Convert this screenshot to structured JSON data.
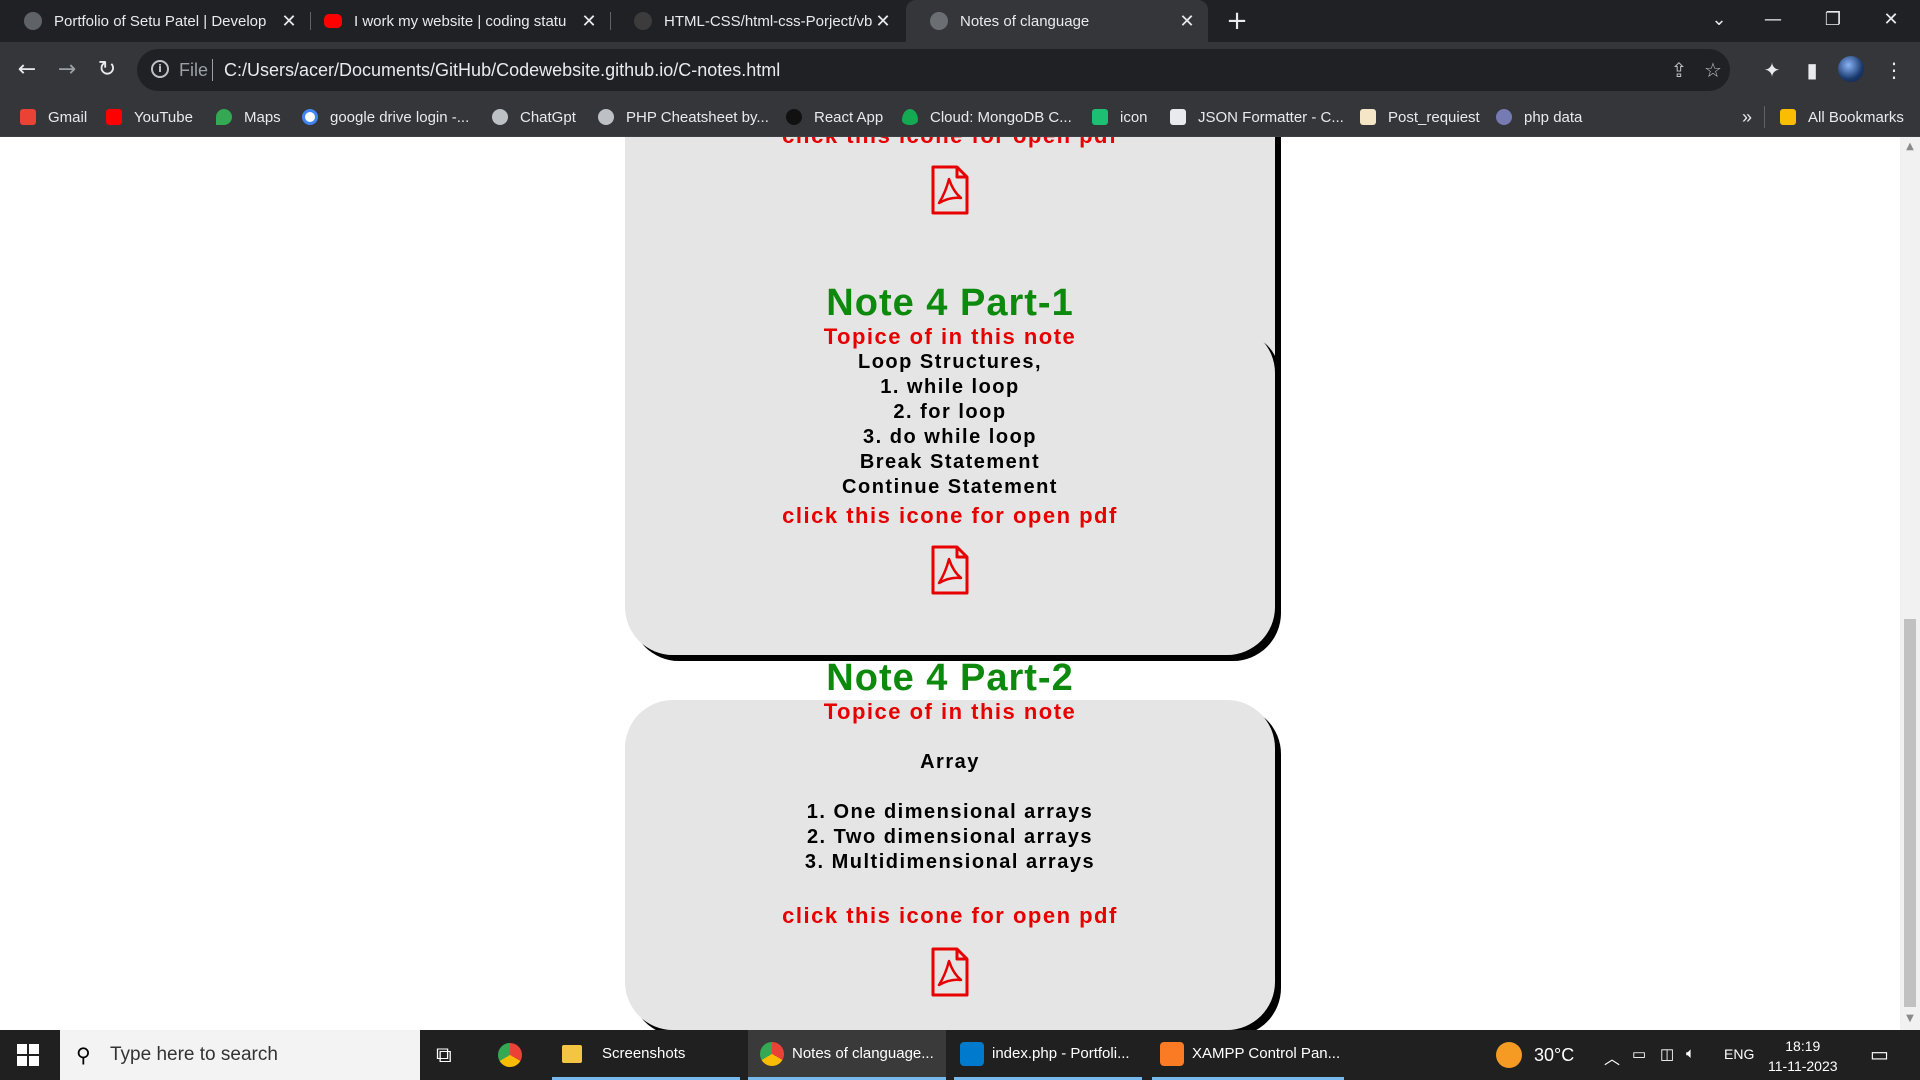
{
  "browser": {
    "tabs": [
      {
        "title": "Portfolio of Setu Patel | Develop",
        "favicon": "globe-icon",
        "active": false
      },
      {
        "title": "I work my website | coding statu",
        "favicon": "youtube-icon",
        "active": false
      },
      {
        "title": "HTML-CSS/html-css-Porject/vb",
        "favicon": "github-icon",
        "active": false
      },
      {
        "title": "Notes of clanguage",
        "favicon": "globe-icon",
        "active": true
      }
    ],
    "close_glyph": "✕",
    "new_tab_glyph": "+",
    "address": {
      "scheme_label": "File",
      "url": "C:/Users/acer/Documents/GitHub/Codewebsite.github.io/C-notes.html"
    },
    "bookmarks": [
      {
        "label": "Gmail",
        "icon": "gmail-icon",
        "color": "#ea4335"
      },
      {
        "label": "YouTube",
        "icon": "youtube-icon",
        "color": "#ff0000"
      },
      {
        "label": "Maps",
        "icon": "maps-icon",
        "color": "#34a853"
      },
      {
        "label": "google drive login -...",
        "icon": "google-icon",
        "color": "#4285f4"
      },
      {
        "label": "ChatGpt",
        "icon": "globe-icon",
        "color": "#bdc1c6"
      },
      {
        "label": "PHP Cheatsheet by...",
        "icon": "globe-icon",
        "color": "#bdc1c6"
      },
      {
        "label": "React App",
        "icon": "react-icon",
        "color": "#222222"
      },
      {
        "label": "Cloud: MongoDB C...",
        "icon": "mongodb-icon",
        "color": "#13aa52"
      },
      {
        "label": "icon",
        "icon": "boxicons-icon",
        "color": "#1dbf73"
      },
      {
        "label": "JSON Formatter - C...",
        "icon": "json-icon",
        "color": "#e8eaed"
      },
      {
        "label": "Post_requiest",
        "icon": "postman-icon",
        "color": "#f5e6c8"
      },
      {
        "label": "php data",
        "icon": "php-icon",
        "color": "#777bb3"
      }
    ],
    "overflow_glyph": "»",
    "all_bookmarks": "All Bookmarks"
  },
  "page": {
    "pdf_link_text": "click this icone for open pdf",
    "topics_heading": "Topice of in this note",
    "notes": [
      {
        "title": "Note 4 Part-1",
        "topics": [
          "Loop Structures,",
          "1. while loop",
          "2. for loop",
          "3. do while loop",
          "Break Statement",
          "Continue Statement"
        ]
      },
      {
        "title": "Note 4 Part-2",
        "topics_group1": [
          "Array"
        ],
        "topics_group2": [
          "1. One dimensional arrays",
          "2. Two dimensional arrays",
          "3. Multidimensional arrays"
        ]
      }
    ],
    "colors": {
      "title": "#0d8a0d",
      "accent_red": "#e60000",
      "card_bg": "#e5e5e5",
      "text": "#000000"
    }
  },
  "taskbar": {
    "search_placeholder": "Type here to search",
    "apps": [
      {
        "label": "Screenshots",
        "icon": "folder-icon"
      },
      {
        "label": "Notes of clanguage...",
        "icon": "chrome-icon"
      },
      {
        "label": "index.php - Portfoli...",
        "icon": "vscode-icon"
      },
      {
        "label": "XAMPP Control Pan...",
        "icon": "xampp-icon"
      }
    ],
    "weather": "30°C",
    "language": "ENG",
    "time": "18:19",
    "date": "11-11-2023"
  }
}
